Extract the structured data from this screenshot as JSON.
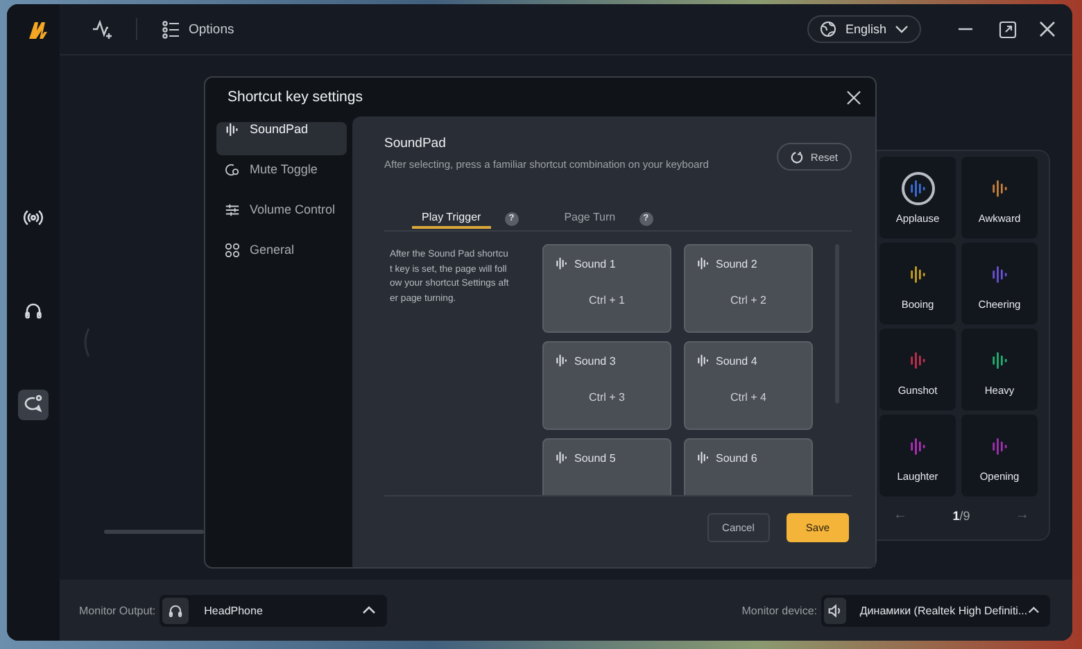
{
  "title_bar": {
    "options_label": "Options",
    "language": "English"
  },
  "rail": [
    {
      "selected": false
    },
    {
      "selected": false
    },
    {
      "selected": true
    }
  ],
  "dialog": {
    "title": "Shortcut key settings",
    "nav": [
      {
        "label": "SoundPad",
        "selected": true
      },
      {
        "label": "Mute Toggle",
        "selected": false
      },
      {
        "label": "Volume Control",
        "selected": false
      },
      {
        "label": "General",
        "selected": false
      }
    ],
    "section_title": "SoundPad",
    "section_description": "After selecting, press a familiar shortcut combination on your keyboard",
    "reset_label": "Reset",
    "tabs": [
      {
        "label": "Play Trigger",
        "hint": "?",
        "selected": true
      },
      {
        "label": "Page Turn",
        "hint": "?",
        "selected": false
      }
    ],
    "note": "After the Sound Pad shortcut key is set, the page will follow your shortcut Settings after page turning.",
    "sounds": [
      {
        "name": "Sound 1",
        "shortcut": "Ctrl + 1"
      },
      {
        "name": "Sound 2",
        "shortcut": "Ctrl + 2"
      },
      {
        "name": "Sound 3",
        "shortcut": "Ctrl + 3"
      },
      {
        "name": "Sound 4",
        "shortcut": "Ctrl + 4"
      },
      {
        "name": "Sound 5"
      },
      {
        "name": "Sound 6"
      }
    ],
    "cancel_label": "Cancel",
    "save_label": "Save"
  },
  "sound_board": {
    "pads": [
      {
        "name": "Applause",
        "color": "#3b6fd6",
        "selected": true
      },
      {
        "name": "Awkward",
        "color": "#c8803a",
        "selected": false
      },
      {
        "name": "Booing",
        "color": "#c8a020",
        "selected": false
      },
      {
        "name": "Cheering",
        "color": "#6a52d6",
        "selected": false
      },
      {
        "name": "Gunshot",
        "color": "#c03050",
        "selected": false
      },
      {
        "name": "Heavy",
        "color": "#22b070",
        "selected": false
      },
      {
        "name": "Laughter",
        "color": "#b030b8",
        "selected": false
      },
      {
        "name": "Opening",
        "color": "#a032b0",
        "selected": false
      }
    ],
    "prev": "←",
    "page": "**1**/9",
    "next": "→"
  },
  "monitor_output": {
    "label": "Monitor Output:",
    "value": "HeadPhone"
  },
  "monitor_device": {
    "label": "Monitor device:",
    "value": "Динамики (Realtek High Definiti..."
  }
}
